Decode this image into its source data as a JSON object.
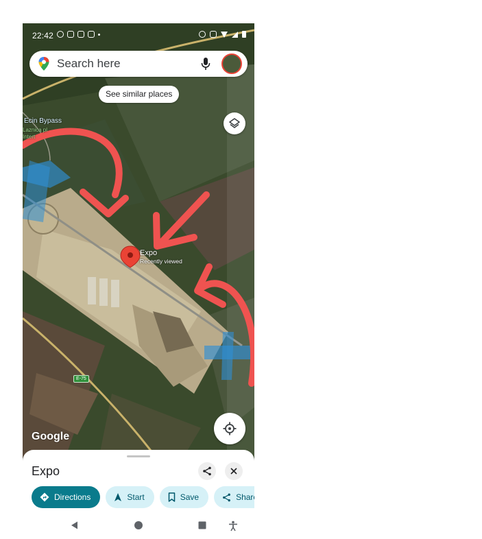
{
  "status_bar": {
    "time": "22:42"
  },
  "search": {
    "placeholder": "Search here"
  },
  "chip": {
    "label": "See similar places"
  },
  "map": {
    "marker": {
      "name": "Expo",
      "subtitle": "Recently viewed"
    },
    "road_label": "Ecin Bypass",
    "road_sublabel_1": "Laznica pl",
    "road_sublabel_2": "Intert",
    "shield": "E-75",
    "logo": "Google"
  },
  "place": {
    "title": "Expo",
    "actions": [
      {
        "label": "Directions",
        "icon": "directions-icon"
      },
      {
        "label": "Start",
        "icon": "navigation-arrow-icon"
      },
      {
        "label": "Save",
        "icon": "bookmark-icon"
      },
      {
        "label": "Share",
        "icon": "share-icon"
      }
    ]
  },
  "colors": {
    "primary": "#0a7b8c",
    "chip_bg": "#d6f1f7",
    "marker": "#ea4335",
    "annotation": "#ef5350",
    "annotation_blue": "#2f8fd6"
  }
}
